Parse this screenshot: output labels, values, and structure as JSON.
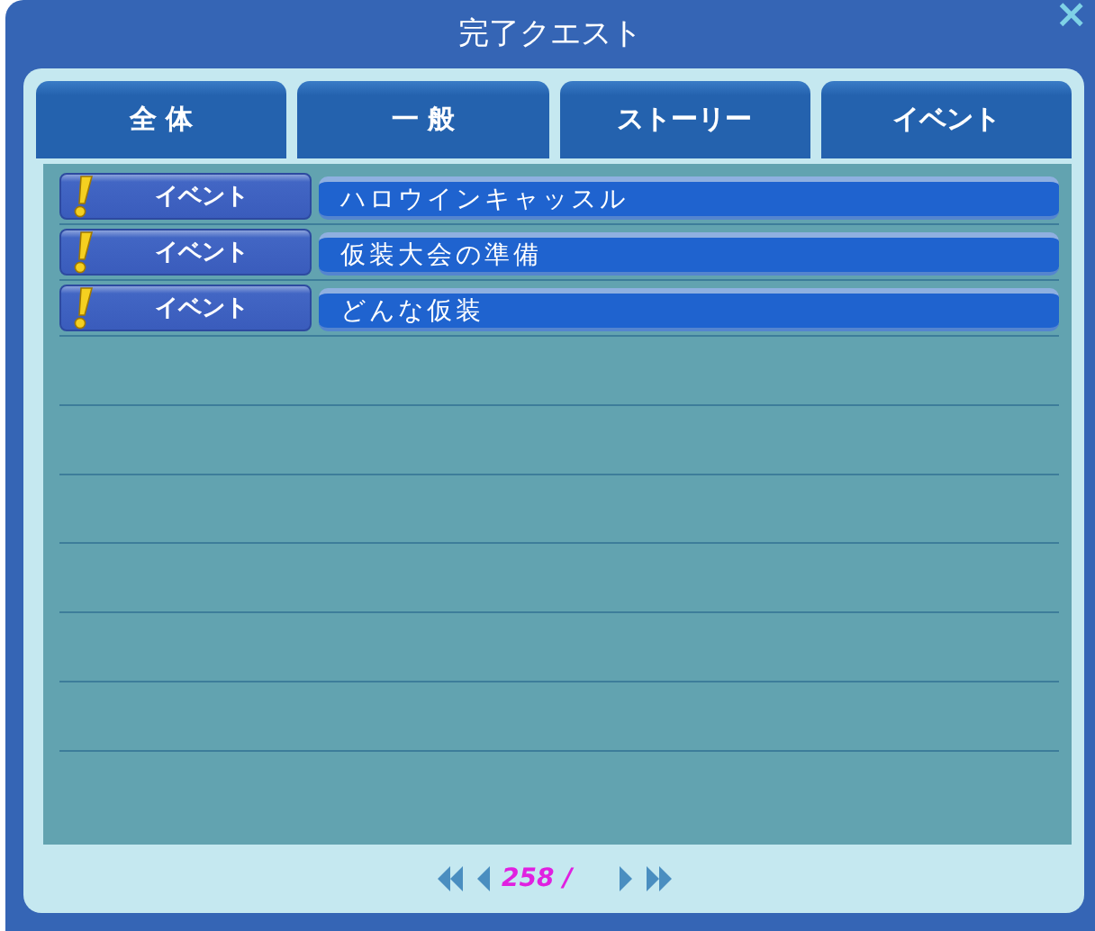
{
  "window": {
    "title": "完了クエスト",
    "close": "×"
  },
  "tabs": [
    {
      "label": "全 体"
    },
    {
      "label": "一 般"
    },
    {
      "label": "ストーリー"
    },
    {
      "label": "イベント"
    }
  ],
  "quests": [
    {
      "category": "イベント",
      "title": "ハロウインキャッスル"
    },
    {
      "category": "イベント",
      "title": "仮装大会の準備"
    },
    {
      "category": "イベント",
      "title": "どんな仮装"
    }
  ],
  "pager": {
    "page": "258 /"
  }
}
